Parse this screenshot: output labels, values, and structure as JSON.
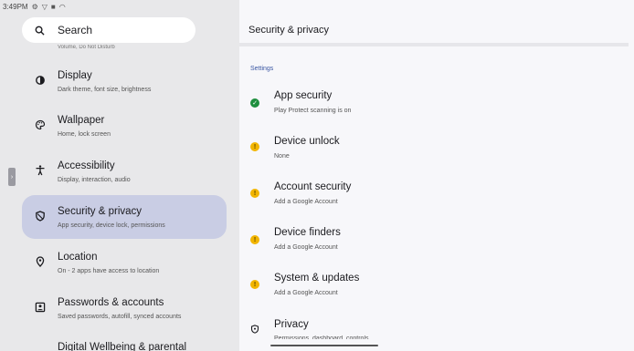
{
  "status_bar": {
    "time": "3:49PM"
  },
  "search": {
    "label": "Search",
    "cut_text": "Volume, Do Not Disturb"
  },
  "left_nav": [
    {
      "title": "Display",
      "sub": "Dark theme, font size, brightness",
      "icon": "display-icon"
    },
    {
      "title": "Wallpaper",
      "sub": "Home, lock screen",
      "icon": "palette-icon"
    },
    {
      "title": "Accessibility",
      "sub": "Display, interaction, audio",
      "icon": "accessibility-icon"
    },
    {
      "title": "Security & privacy",
      "sub": "App security, device lock, permissions",
      "icon": "shield-icon"
    },
    {
      "title": "Location",
      "sub": "On - 2 apps have access to location",
      "icon": "location-icon"
    },
    {
      "title": "Passwords & accounts",
      "sub": "Saved passwords, autofill, synced accounts",
      "icon": "account-icon"
    }
  ],
  "left_nav_cut_title": "Digital Wellbeing & parental",
  "page": {
    "title": "Security & privacy",
    "section_label": "Settings",
    "items": [
      {
        "title": "App security",
        "sub": "Play Protect scanning is on",
        "status": "ok"
      },
      {
        "title": "Device unlock",
        "sub": "None",
        "status": "warning"
      },
      {
        "title": "Account security",
        "sub": "Add a Google Account",
        "status": "warning"
      },
      {
        "title": "Device finders",
        "sub": "Add a Google Account",
        "status": "warning"
      },
      {
        "title": "System & updates",
        "sub": "Add a Google Account",
        "status": "warning"
      },
      {
        "title": "Privacy",
        "sub": "Permissions, dashboard, controls",
        "status": "shield"
      }
    ]
  },
  "colors": {
    "active_nav": "#c9cde4",
    "ok": "#1e8e3e",
    "warning": "#f2b500",
    "section_label": "#3a56a3"
  }
}
